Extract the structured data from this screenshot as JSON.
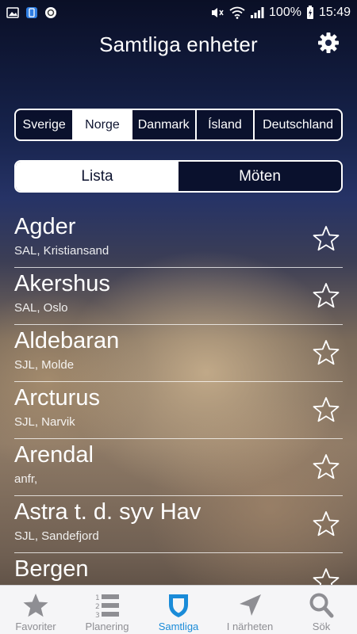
{
  "statusbar": {
    "battery": "100%",
    "time": "15:49"
  },
  "header": {
    "title": "Samtliga enheter"
  },
  "countries": [
    {
      "label": "Sverige",
      "active": false
    },
    {
      "label": "Norge",
      "active": true
    },
    {
      "label": "Danmark",
      "active": false
    },
    {
      "label": "Ísland",
      "active": false
    },
    {
      "label": "Deutschland",
      "active": false
    }
  ],
  "view_tabs": [
    {
      "label": "Lista",
      "active": true
    },
    {
      "label": "Möten",
      "active": false
    }
  ],
  "items": [
    {
      "name": "Agder",
      "sub": "SAL, Kristiansand"
    },
    {
      "name": "Akershus",
      "sub": "SAL, Oslo"
    },
    {
      "name": "Aldebaran",
      "sub": "SJL, Molde"
    },
    {
      "name": "Arcturus",
      "sub": "SJL, Narvik"
    },
    {
      "name": "Arendal",
      "sub": "anfr,"
    },
    {
      "name": "Astra t. d. syv Hav",
      "sub": "SJL, Sandefjord"
    },
    {
      "name": "Bergen",
      "sub": ""
    }
  ],
  "tabbar": [
    {
      "label": "Favoriter",
      "icon": "star-icon",
      "active": false
    },
    {
      "label": "Planering",
      "icon": "numbered-list-icon",
      "active": false
    },
    {
      "label": "Samtliga",
      "icon": "shield-icon",
      "active": true
    },
    {
      "label": "I närheten",
      "icon": "location-arrow-icon",
      "active": false
    },
    {
      "label": "Sök",
      "icon": "search-icon",
      "active": false
    }
  ]
}
